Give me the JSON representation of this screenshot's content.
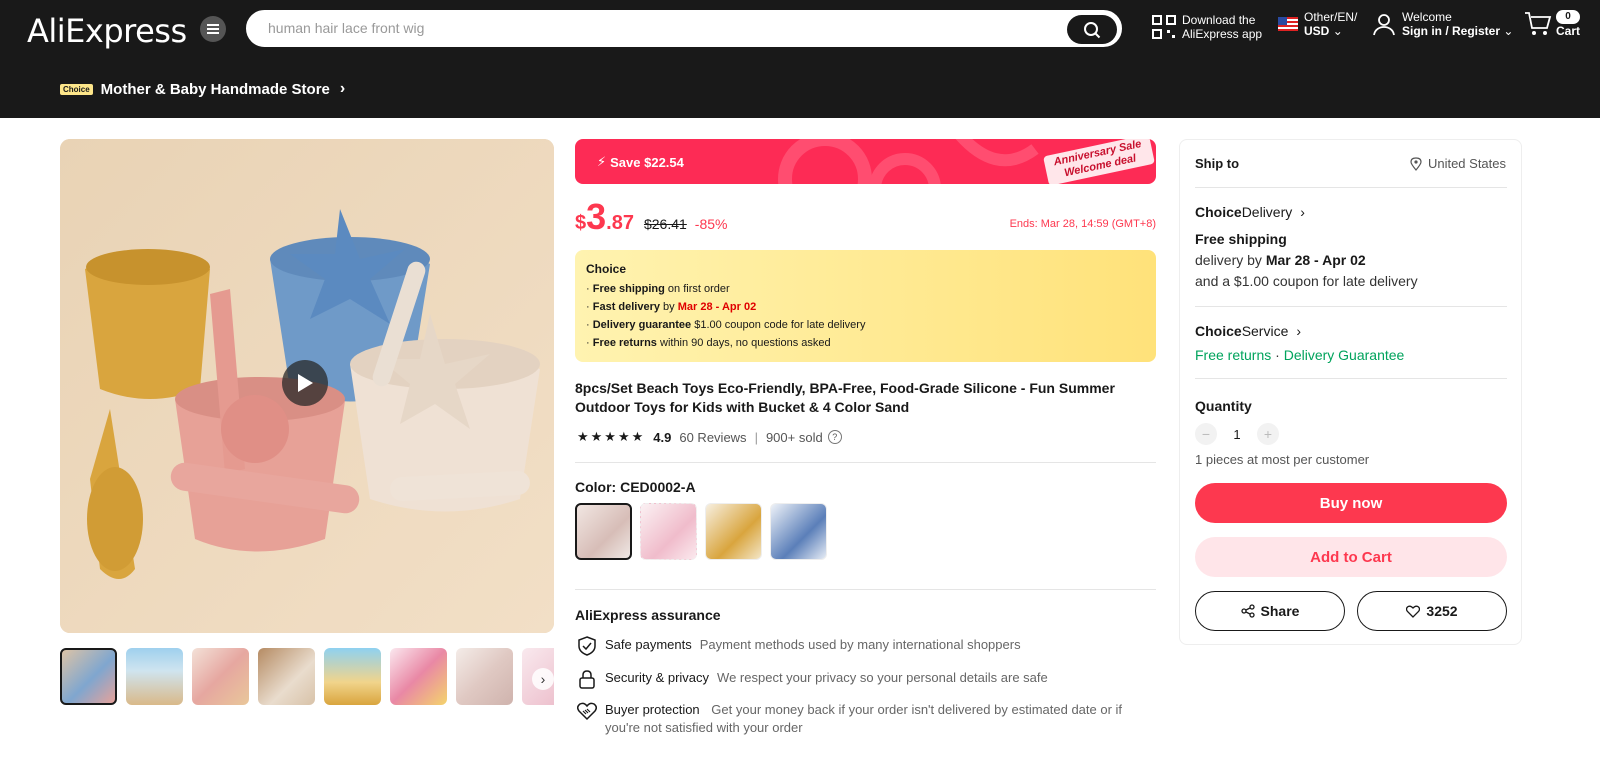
{
  "header": {
    "logo": "AliExpress",
    "search_placeholder": "human hair lace front wig",
    "download_line1": "Download the",
    "download_line2": "AliExpress app",
    "lang_line1": "Other/EN/",
    "lang_line2": "USD",
    "welcome": "Welcome",
    "signin": "Sign in / Register",
    "cart_count": "0",
    "cart_label": "Cart"
  },
  "store": {
    "badge": "Choice",
    "name": "Mother & Baby Handmade Store"
  },
  "promo": {
    "save": "Save $22.54",
    "tag_line1": "Anniversary Sale",
    "tag_line2": "Welcome deal"
  },
  "price": {
    "currency": "$",
    "integer": "3",
    "decimal": ".87",
    "original": "$26.41",
    "discount": "-85%",
    "ends": "Ends: Mar 28, 14:59 (GMT+8)"
  },
  "choice": {
    "title": "Choice",
    "l1_bold": "Free shipping",
    "l1_rest": " on first order",
    "l2_bold": "Fast delivery",
    "l2_mid": " by ",
    "l2_red": "Mar 28 - Apr 02",
    "l3_bold": "Delivery guarantee",
    "l3_rest": "  $1.00 coupon code for late delivery",
    "l4_bold": "Free returns",
    "l4_rest": "  within 90 days, no questions asked"
  },
  "product": {
    "title": "8pcs/Set Beach Toys Eco-Friendly, BPA-Free, Food-Grade Silicone - Fun Summer Outdoor Toys for Kids with Bucket & 4 Color Sand",
    "stars": "★★★★★",
    "rating": "4.9",
    "reviews": "60 Reviews",
    "sold": "900+ sold",
    "color_label": "Color: CED0002-A"
  },
  "assurance": {
    "title": "AliExpress assurance",
    "items": [
      {
        "name": "Safe payments",
        "desc": "Payment methods used by many international shoppers"
      },
      {
        "name": "Security & privacy",
        "desc": "We respect your privacy so your personal details are safe"
      },
      {
        "name": "Buyer protection",
        "desc": "Get your money back if your order isn't delivered by estimated date or if you're not satisfied with your order"
      }
    ]
  },
  "panel": {
    "ship_to": "Ship to",
    "country": "United States",
    "delivery_choice": "Choice",
    "delivery_label": " Delivery",
    "free_shipping": "Free shipping",
    "delivery_by": "delivery by ",
    "delivery_dates": "Mar 28 - Apr 02",
    "coupon": "and a $1.00 coupon for late delivery",
    "service_choice": "Choice",
    "service_label": " Service",
    "free_returns": "Free returns",
    "dot": " · ",
    "delivery_guarantee": "Delivery Guarantee",
    "quantity_label": "Quantity",
    "quantity": "1",
    "qty_note": "1 pieces at most per customer",
    "buy_now": "Buy now",
    "add_to_cart": "Add to Cart",
    "share": "Share",
    "wishlist": "3252"
  },
  "colors": {
    "accent": "#fd384f",
    "header_bg": "#191919",
    "green": "#00a35c"
  }
}
